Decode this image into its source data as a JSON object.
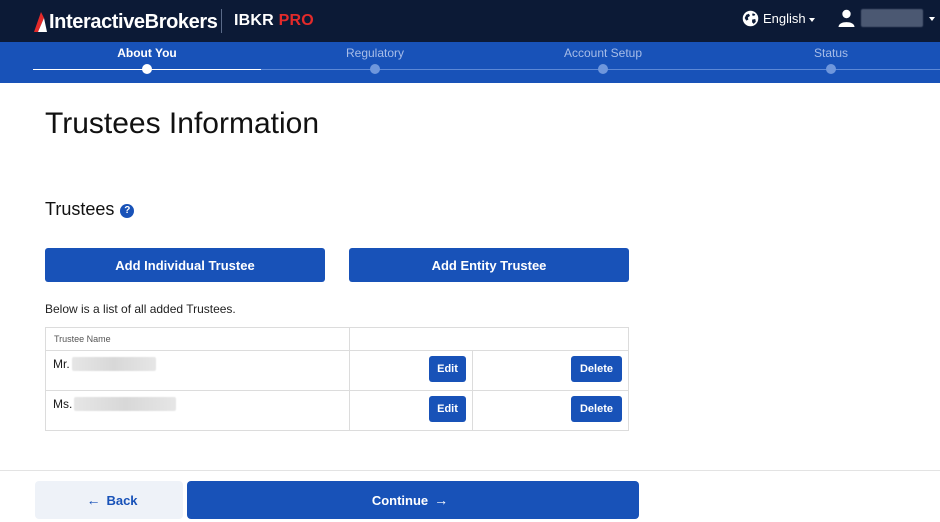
{
  "header": {
    "brand_part1": "Interactive",
    "brand_part2": "Brokers",
    "product_part1": "IBKR",
    "product_part2": "PRO",
    "language": "English"
  },
  "steps": [
    {
      "label": "About You",
      "active": true
    },
    {
      "label": "Regulatory",
      "active": false
    },
    {
      "label": "Account Setup",
      "active": false
    },
    {
      "label": "Status",
      "active": false
    }
  ],
  "page": {
    "title": "Trustees Information",
    "section_title": "Trustees",
    "add_individual_label": "Add Individual Trustee",
    "add_entity_label": "Add Entity Trustee",
    "list_description": "Below is a list of all added Trustees."
  },
  "table": {
    "header_name": "Trustee Name",
    "rows": [
      {
        "prefix": "Mr.",
        "edit_label": "Edit",
        "delete_label": "Delete"
      },
      {
        "prefix": "Ms.",
        "edit_label": "Edit",
        "delete_label": "Delete"
      }
    ]
  },
  "footer": {
    "back_label": "Back",
    "continue_label": "Continue"
  },
  "colors": {
    "header_bg": "#0c1a36",
    "accent": "#1852b8",
    "pro_red": "#e32a2a"
  }
}
